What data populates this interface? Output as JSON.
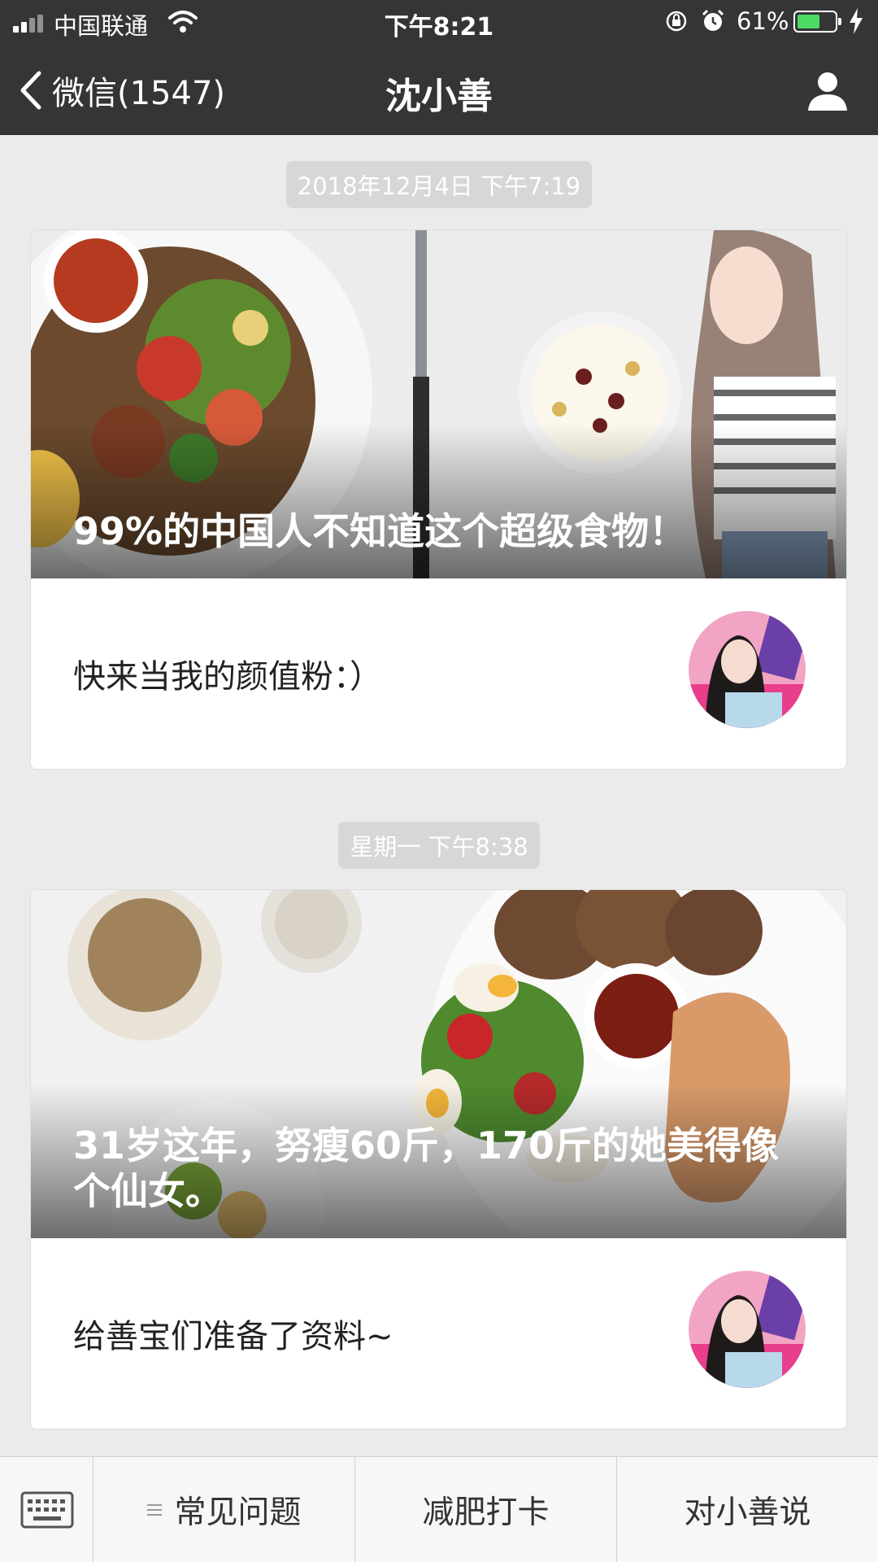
{
  "status_bar": {
    "carrier": "中国联通",
    "time": "下午8:21",
    "battery_percent": "61%",
    "battery_level": 0.61,
    "icons": [
      "signal-icon",
      "wifi-icon",
      "rotation-lock-icon",
      "alarm-icon",
      "battery-icon",
      "charging-icon"
    ]
  },
  "nav": {
    "back_label": "微信(1547)",
    "title": "沈小善",
    "profile_icon": "person-icon"
  },
  "messages": [
    {
      "timestamp": "2018年12月4日 下午7:19",
      "headline": "99%的中国人不知道这个超级食物！",
      "summary": "快来当我的颜值粉：）"
    },
    {
      "timestamp": "星期一 下午8:38",
      "headline": "31岁这年，努瘦60斤，170斤的她美得像个仙女。",
      "summary": "给善宝们准备了资料~"
    }
  ],
  "menu": {
    "keyboard_icon": "keyboard-icon",
    "items": [
      "常见问题",
      "减肥打卡",
      "对小善说"
    ],
    "submenu_icon": "menu-lines-icon"
  },
  "colors": {
    "top_bar": "#353535",
    "background": "#ebebeb",
    "battery_fill": "#4cd964"
  }
}
